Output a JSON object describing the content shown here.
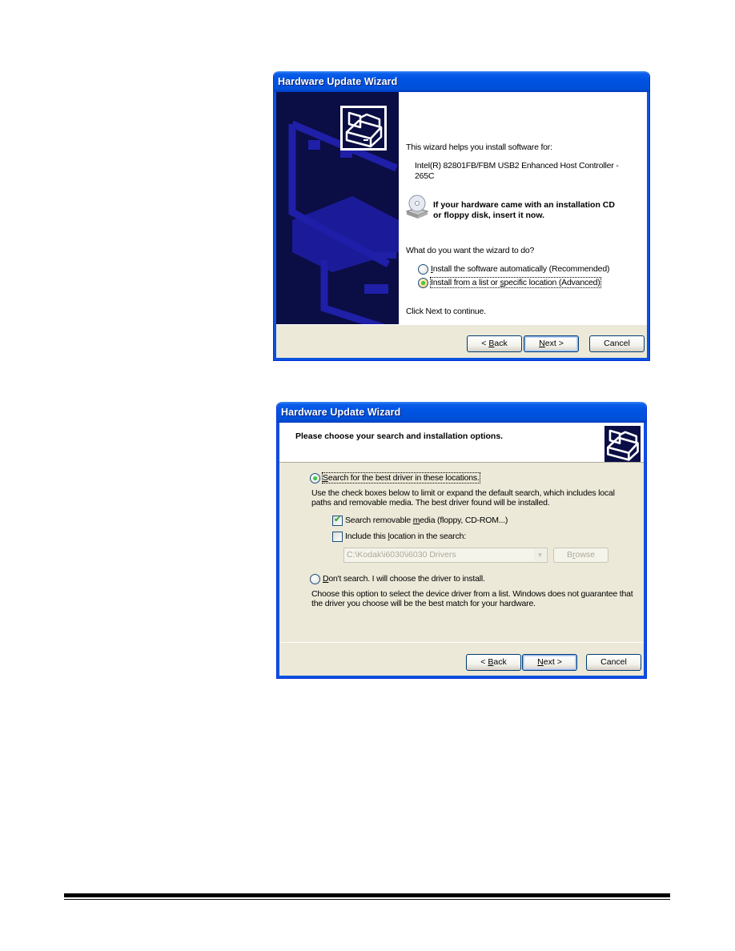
{
  "dialog1": {
    "title": "Hardware Update Wizard",
    "intro": "This wizard helps you install software for:",
    "device_line1": "Intel(R) 82801FB/FBM USB2 Enhanced Host Controller -",
    "device_line2": "265C",
    "cd_notice_line1": "If your hardware came with an installation CD",
    "cd_notice_line2": "or floppy disk, insert it now.",
    "question": "What do you want the wizard to do?",
    "options": [
      {
        "label": "Install the software automatically (Recommended)",
        "selected": false
      },
      {
        "label": "Install from a list or specific location (Advanced)",
        "selected": true
      }
    ],
    "continue_hint": "Click Next to continue.",
    "buttons": {
      "back": "< Back",
      "next": "Next >",
      "cancel": "Cancel"
    },
    "icons": {
      "hardware": "hardware-wizard-icon",
      "cd": "cd-drive-icon"
    }
  },
  "dialog2": {
    "title": "Hardware Update Wizard",
    "header": "Please choose your search and installation options.",
    "search_option": {
      "label": "Search for the best driver in these locations.",
      "selected": true
    },
    "search_desc_line1": "Use the check boxes below to limit or expand the default search, which includes local",
    "search_desc_line2": "paths and removable media. The best driver found will be installed.",
    "checkboxes": [
      {
        "label": "Search removable media (floppy, CD-ROM...)",
        "checked": true
      },
      {
        "label": "Include this location in the search:",
        "checked": false
      }
    ],
    "location_value": "C:\\Kodak\\i6030\\i6030 Drivers",
    "browse_label": "Browse",
    "dont_search_option": {
      "label": "Don't search. I will choose the driver to install.",
      "selected": false
    },
    "dont_search_desc_line1": "Choose this option to select the device driver from a list.  Windows does not guarantee that",
    "dont_search_desc_line2": "the driver you choose will be the best match for your hardware.",
    "buttons": {
      "back": "< Back",
      "next": "Next >",
      "cancel": "Cancel"
    }
  },
  "colors": {
    "titlebar": "#0054e3",
    "dialog_bg": "#ece9d8",
    "wizard_side": "#0b0d45",
    "accent_green": "#21a121"
  }
}
